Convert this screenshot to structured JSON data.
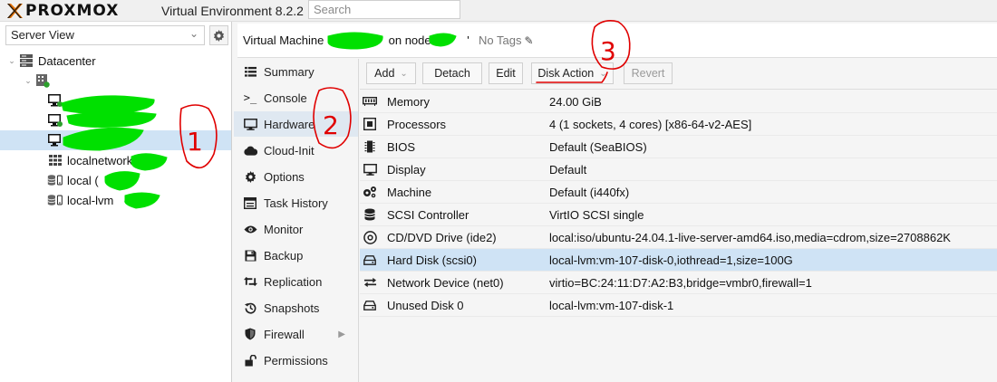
{
  "topbar": {
    "logo_text": "PROXMOX",
    "app_title": "Virtual Environment 8.2.2",
    "search_placeholder": "Search"
  },
  "tree_panel": {
    "view_label": "Server View",
    "items": [
      {
        "label": "Datacenter",
        "icon": "datacenter-icon"
      },
      {
        "label": "",
        "icon": "node-icon"
      },
      {
        "label": "",
        "icon": "vm-running-icon"
      },
      {
        "label": "",
        "icon": "vm-running-icon"
      },
      {
        "label": "",
        "icon": "vm-stopped-icon"
      },
      {
        "label": "localnetwork",
        "icon": "network-grid-icon"
      },
      {
        "label": "local (",
        "icon": "storage-icon"
      },
      {
        "label": "local-lvm",
        "icon": "storage-icon"
      }
    ]
  },
  "header": {
    "title_prefix": "Virtual Machine",
    "node_label": "on node",
    "node_suffix": "'",
    "tags_label": "No Tags"
  },
  "nav": {
    "items": [
      {
        "label": "Summary",
        "icon": "summary-icon"
      },
      {
        "label": "Console",
        "icon": "console-icon"
      },
      {
        "label": "Hardware",
        "icon": "hardware-icon"
      },
      {
        "label": "Cloud-Init",
        "icon": "cloud-icon"
      },
      {
        "label": "Options",
        "icon": "gear-icon"
      },
      {
        "label": "Task History",
        "icon": "list-icon"
      },
      {
        "label": "Monitor",
        "icon": "eye-icon"
      },
      {
        "label": "Backup",
        "icon": "backup-icon"
      },
      {
        "label": "Replication",
        "icon": "retweet-icon"
      },
      {
        "label": "Snapshots",
        "icon": "history-icon"
      },
      {
        "label": "Firewall",
        "icon": "shield-icon"
      },
      {
        "label": "Permissions",
        "icon": "unlock-icon"
      }
    ],
    "active_index": 2
  },
  "toolbar": {
    "add": "Add",
    "detach": "Detach",
    "edit": "Edit",
    "disk_action": "Disk Action",
    "revert": "Revert"
  },
  "hardware": {
    "rows": [
      {
        "name": "Memory",
        "value": "24.00 GiB",
        "icon": "memory-icon"
      },
      {
        "name": "Processors",
        "value": "4 (1 sockets, 4 cores) [x86-64-v2-AES]",
        "icon": "cpu-icon"
      },
      {
        "name": "BIOS",
        "value": "Default (SeaBIOS)",
        "icon": "microchip-icon"
      },
      {
        "name": "Display",
        "value": "Default",
        "icon": "desktop-icon"
      },
      {
        "name": "Machine",
        "value": "Default (i440fx)",
        "icon": "cogs-icon"
      },
      {
        "name": "SCSI Controller",
        "value": "VirtIO SCSI single",
        "icon": "database-icon"
      },
      {
        "name": "CD/DVD Drive (ide2)",
        "value": "local:iso/ubuntu-24.04.1-live-server-amd64.iso,media=cdrom,size=2708862K",
        "icon": "cdrom-icon"
      },
      {
        "name": "Hard Disk (scsi0)",
        "value": "local-lvm:vm-107-disk-0,iothread=1,size=100G",
        "icon": "hdd-icon"
      },
      {
        "name": "Network Device (net0)",
        "value": "virtio=BC:24:11:D7:A2:B3,bridge=vmbr0,firewall=1",
        "icon": "exchange-icon"
      },
      {
        "name": "Unused Disk 0",
        "value": "local-lvm:vm-107-disk-1",
        "icon": "hdd-icon"
      }
    ],
    "selected_index": 7
  },
  "annotations": {
    "marks": [
      "1",
      "2",
      "3"
    ],
    "pen_color": "#e00000",
    "redaction_color": "#00e000"
  },
  "colors": {
    "selection": "#cfe3f5",
    "running": "#2ca02c",
    "accent": "#e57000"
  }
}
